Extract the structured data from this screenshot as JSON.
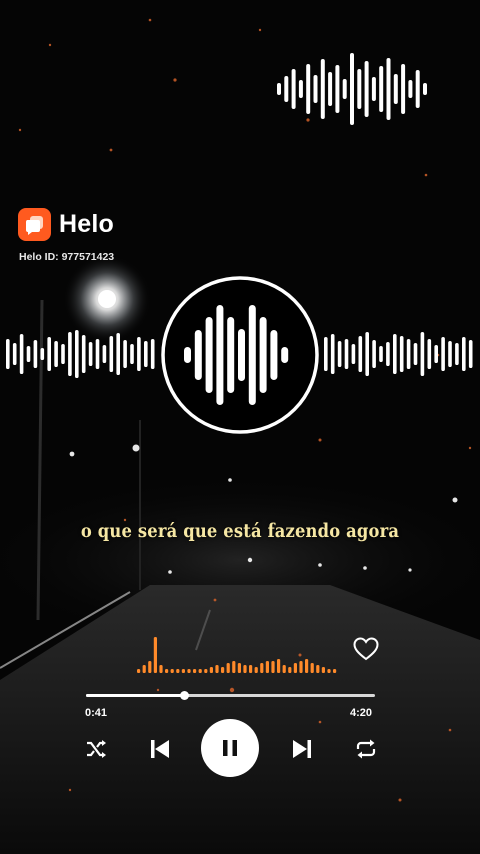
{
  "brand": {
    "name": "Helo",
    "helo_id": "Helo ID: 977571423"
  },
  "lyric": "o que será que está fazendo agora",
  "player": {
    "elapsed": "0:41",
    "total": "4:20",
    "progress": 0.34,
    "state": "playing"
  },
  "icons": {
    "shuffle": "shuffle-icon",
    "previous": "skip-previous-icon",
    "pause": "pause-icon",
    "next": "skip-next-icon",
    "repeat": "repeat-icon",
    "like": "heart-outline-icon",
    "brand_logo": "helo-logo-icon"
  },
  "colors": {
    "background": "#050505",
    "lyric": "#f6e7a4",
    "equalizer": "#ff8a2a",
    "brand_accent": "#ff5a1f",
    "control": "#ffffff",
    "play_icon": "#111111"
  }
}
